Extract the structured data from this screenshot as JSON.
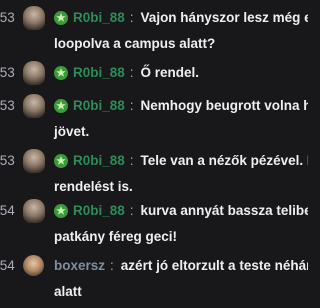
{
  "messages": [
    {
      "time": ":53",
      "user": "R0bi_88",
      "sep": ":",
      "line1": "Vajon hányszor lesz még ez",
      "line2": "loopolva a campus alatt?"
    },
    {
      "time": ":53",
      "user": "R0bi_88",
      "sep": ":",
      "line1": "Ő rendel.",
      "line2": ""
    },
    {
      "time": ":53",
      "user": "R0bi_88",
      "sep": ":",
      "line1": "Nemhogy beugrott volna haza",
      "line2": "jövet."
    },
    {
      "time": ":53",
      "user": "R0bi_88",
      "sep": ":",
      "line1": "Tele van a nézők pézével. Fiz",
      "line2": "rendelést is."
    },
    {
      "time": ":54",
      "user": "R0bi_88",
      "sep": ":",
      "line1": "kurva annyát bassza telibe ez",
      "line2": "patkány féreg geci!"
    },
    {
      "time": ":54",
      "user": "boxersz",
      "sep": ":",
      "line1": "azért jó eltorzult a teste néhány év",
      "line2": "alatt"
    }
  ],
  "colors": {
    "background": "#18181b",
    "username_robi": "#2e8b57",
    "username_boxersz": "#7f8fa0",
    "timestamp": "#adadb8",
    "message_text": "#efeff1"
  },
  "icons": {
    "badge": "green-sub-badge-icon",
    "avatar_robi": "avatar",
    "avatar_boxersz": "avatar"
  }
}
